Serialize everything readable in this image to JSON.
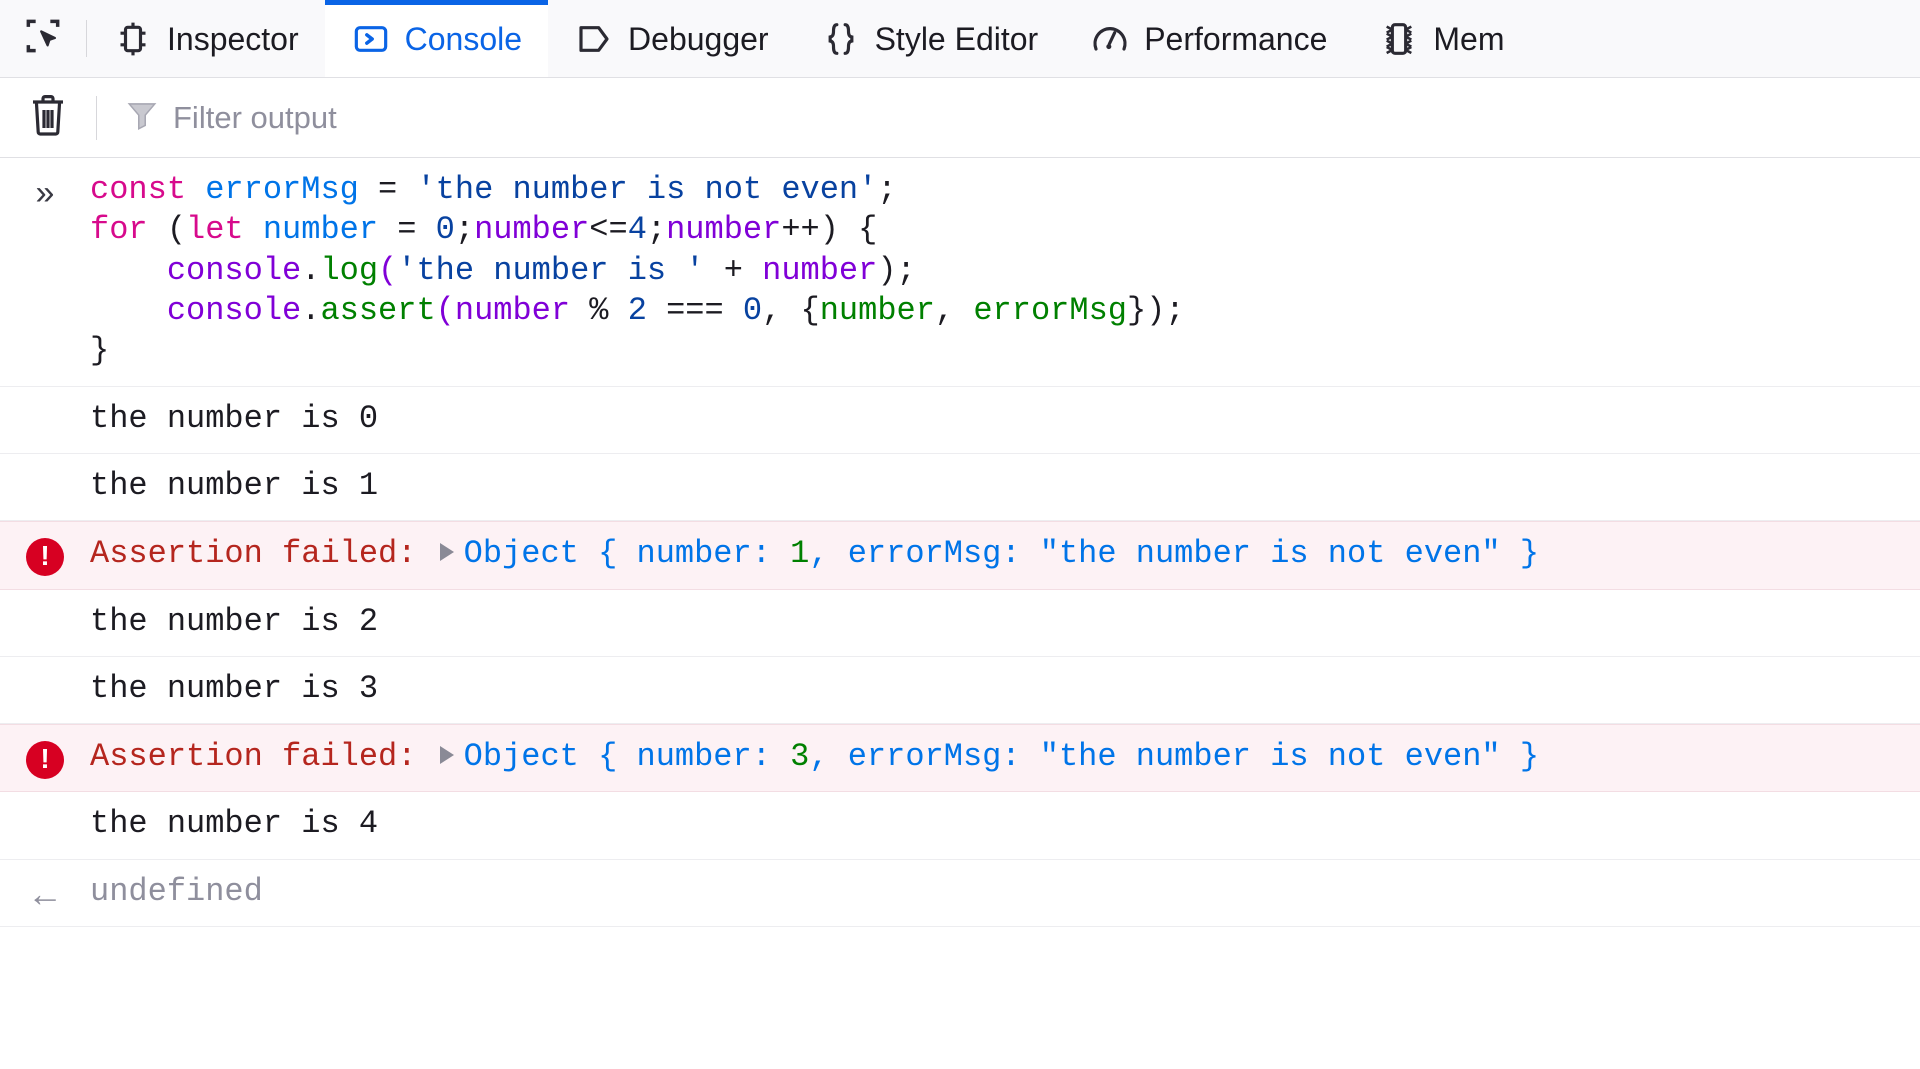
{
  "toolbar": {
    "picker_icon": "element-picker-icon",
    "tabs": [
      {
        "label": "Inspector",
        "icon": "inspector-icon",
        "active": false
      },
      {
        "label": "Console",
        "icon": "console-icon",
        "active": true
      },
      {
        "label": "Debugger",
        "icon": "debugger-icon",
        "active": false
      },
      {
        "label": "Style Editor",
        "icon": "style-editor-icon",
        "active": false
      },
      {
        "label": "Performance",
        "icon": "performance-icon",
        "active": false
      },
      {
        "label": "Mem",
        "icon": "memory-icon",
        "active": false
      }
    ],
    "active_tab_color": "#0a64e6"
  },
  "filter_bar": {
    "clear_icon": "trash-icon",
    "filter_icon": "funnel-icon",
    "placeholder": "Filter output",
    "value": ""
  },
  "console": {
    "input_marker": "»",
    "return_marker": "←",
    "error_icon_glyph": "!",
    "rows": [
      {
        "type": "input",
        "name": "console-input-expression",
        "lines": [
          [
            {
              "t": "const ",
              "c": "tok-kw"
            },
            {
              "t": "errorMsg",
              "c": "tok-var"
            },
            {
              "t": " = ",
              "c": "tok-plain"
            },
            {
              "t": "'the number is not even'",
              "c": "tok-str"
            },
            {
              "t": ";",
              "c": "tok-plain"
            }
          ],
          [
            {
              "t": "for ",
              "c": "tok-kw"
            },
            {
              "t": "(",
              "c": "tok-plain"
            },
            {
              "t": "let ",
              "c": "tok-kw"
            },
            {
              "t": "number",
              "c": "tok-var"
            },
            {
              "t": " = ",
              "c": "tok-plain"
            },
            {
              "t": "0",
              "c": "tok-num"
            },
            {
              "t": ";",
              "c": "tok-plain"
            },
            {
              "t": "number",
              "c": "tok-purple"
            },
            {
              "t": "<=",
              "c": "tok-plain"
            },
            {
              "t": "4",
              "c": "tok-num"
            },
            {
              "t": ";",
              "c": "tok-plain"
            },
            {
              "t": "number",
              "c": "tok-purple"
            },
            {
              "t": "++) {",
              "c": "tok-plain"
            }
          ],
          [
            {
              "t": "    ",
              "c": "tok-plain"
            },
            {
              "t": "console",
              "c": "tok-purple"
            },
            {
              "t": ".",
              "c": "tok-plain"
            },
            {
              "t": "log",
              "c": "tok-green"
            },
            {
              "t": "(",
              "c": "tok-purple"
            },
            {
              "t": "'the number is '",
              "c": "tok-str"
            },
            {
              "t": " + ",
              "c": "tok-plain"
            },
            {
              "t": "number",
              "c": "tok-purple"
            },
            {
              "t": ");",
              "c": "tok-plain"
            }
          ],
          [
            {
              "t": "    ",
              "c": "tok-plain"
            },
            {
              "t": "console",
              "c": "tok-purple"
            },
            {
              "t": ".",
              "c": "tok-plain"
            },
            {
              "t": "assert",
              "c": "tok-green"
            },
            {
              "t": "(",
              "c": "tok-purple"
            },
            {
              "t": "number",
              "c": "tok-purple"
            },
            {
              "t": " % ",
              "c": "tok-plain"
            },
            {
              "t": "2",
              "c": "tok-num"
            },
            {
              "t": " === ",
              "c": "tok-plain"
            },
            {
              "t": "0",
              "c": "tok-num"
            },
            {
              "t": ", {",
              "c": "tok-plain"
            },
            {
              "t": "number",
              "c": "tok-green"
            },
            {
              "t": ", ",
              "c": "tok-plain"
            },
            {
              "t": "errorMsg",
              "c": "tok-green"
            },
            {
              "t": "});",
              "c": "tok-plain"
            }
          ],
          [
            {
              "t": "}",
              "c": "tok-plain"
            }
          ]
        ]
      },
      {
        "type": "log",
        "name": "console-log-row",
        "text": "the number is 0"
      },
      {
        "type": "log",
        "name": "console-log-row",
        "text": "the number is 1"
      },
      {
        "type": "error",
        "name": "console-assertion-row",
        "label": "Assertion failed:",
        "object": {
          "prefix": "Object { ",
          "key1": "number",
          "sep1": ": ",
          "val1": "1",
          "comma": ", ",
          "key2": "errorMsg",
          "sep2": ": ",
          "val2": "\"the number is not even\"",
          "suffix": " }"
        }
      },
      {
        "type": "log",
        "name": "console-log-row",
        "text": "the number is 2"
      },
      {
        "type": "log",
        "name": "console-log-row",
        "text": "the number is 3"
      },
      {
        "type": "error",
        "name": "console-assertion-row",
        "label": "Assertion failed:",
        "object": {
          "prefix": "Object { ",
          "key1": "number",
          "sep1": ": ",
          "val1": "3",
          "comma": ", ",
          "key2": "errorMsg",
          "sep2": ": ",
          "val2": "\"the number is not even\"",
          "suffix": " }"
        }
      },
      {
        "type": "log",
        "name": "console-log-row",
        "text": "the number is 4"
      },
      {
        "type": "return",
        "name": "console-return-row",
        "text": "undefined"
      }
    ]
  }
}
